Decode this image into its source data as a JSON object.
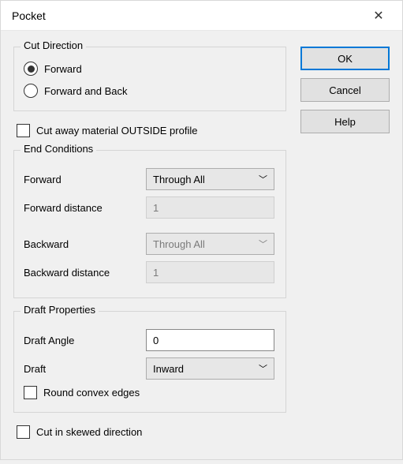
{
  "window": {
    "title": "Pocket",
    "close_glyph": "✕"
  },
  "buttons": {
    "ok": "OK",
    "cancel": "Cancel",
    "help": "Help"
  },
  "cut_direction": {
    "legend": "Cut Direction",
    "forward": "Forward",
    "forward_and_back": "Forward and Back",
    "selected": "forward"
  },
  "cut_away": {
    "label": "Cut away material OUTSIDE profile",
    "checked": false
  },
  "end_conditions": {
    "legend": "End Conditions",
    "forward_label": "Forward",
    "forward_value": "Through All",
    "forward_distance_label": "Forward distance",
    "forward_distance_value": "1",
    "backward_label": "Backward",
    "backward_value": "Through All",
    "backward_distance_label": "Backward distance",
    "backward_distance_value": "1"
  },
  "draft_properties": {
    "legend": "Draft Properties",
    "angle_label": "Draft Angle",
    "angle_value": "0",
    "draft_label": "Draft",
    "draft_value": "Inward",
    "round_label": "Round convex edges",
    "round_checked": false
  },
  "skewed": {
    "label": "Cut in skewed direction",
    "checked": false
  }
}
